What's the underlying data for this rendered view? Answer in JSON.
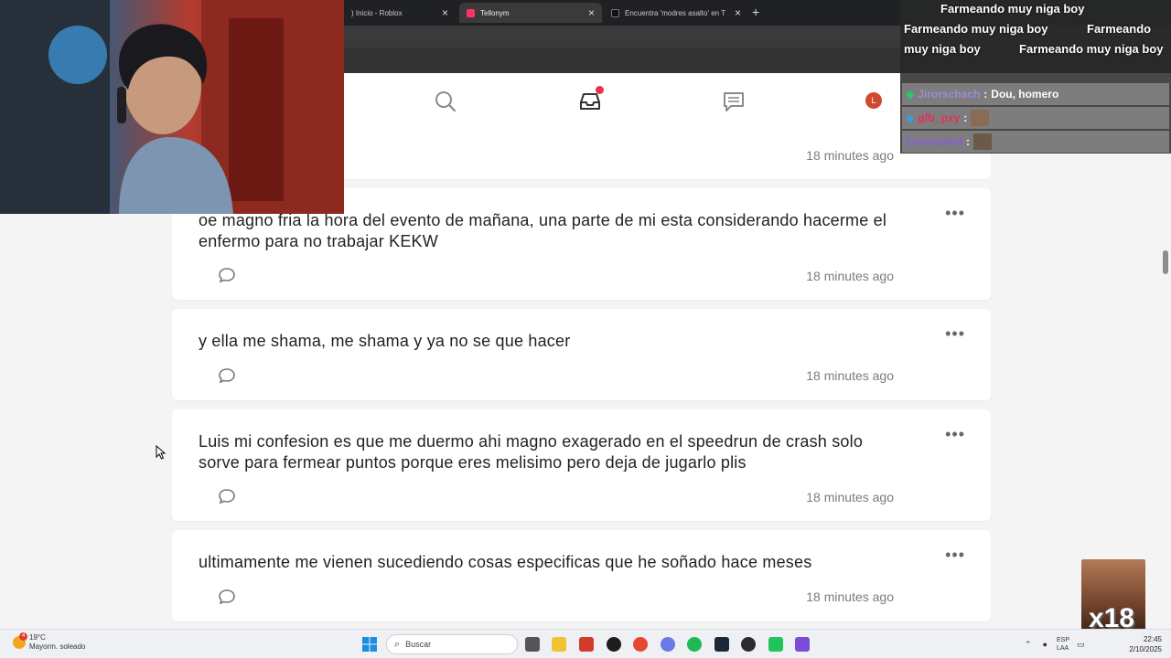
{
  "browser": {
    "tabs": [
      {
        "title": ") Inicio - Roblox",
        "active": false,
        "favicon_color": "#444444"
      },
      {
        "title": "Tellonym",
        "active": true,
        "favicon_color": "#ff3366"
      },
      {
        "title": "Encuentra 'modres asalto' en T",
        "active": false,
        "favicon_color": "#111111"
      }
    ],
    "new_tab": "+"
  },
  "appnav": {
    "avatar_letter": "L",
    "accent": "#e8334a"
  },
  "feed": {
    "cards": [
      {
        "message": "",
        "time": "18 minutes ago"
      },
      {
        "message": "oe magno fria la hora del evento de mañana, una parte de mi esta considerando hacerme el enfermo para no trabajar KEKW",
        "time": "18 minutes ago"
      },
      {
        "message": "y ella me shama, me shama y ya no se que hacer",
        "time": "18 minutes ago"
      },
      {
        "message": "Luis mi confesion es que me duermo ahi magno exagerado en el speedrun de crash solo sorve para fermear puntos porque eres melisimo pero deja de jugarlo plis",
        "time": "18 minutes ago"
      },
      {
        "message": "ultimamente me vienen sucediendo cosas especificas que he soñado hace meses",
        "time": "18 minutes ago"
      }
    ],
    "more_glyph": "•••"
  },
  "chat": {
    "farm_text": "Farmeando muy niga boy",
    "farm_text_split_a": "Farmeando",
    "farm_text_split_b": "muy niga boy",
    "messages": [
      {
        "user": "Jirorschach",
        "sep": ":",
        "text": "Dou, homero",
        "user_color": "#9d8bd8"
      },
      {
        "user": "gfb_pxy",
        "sep": ":",
        "text": "",
        "user_color": "#e0325a"
      },
      {
        "user": "Coctresmil",
        "sep": ":",
        "text": "",
        "user_color": "#8b5bd8"
      }
    ]
  },
  "sticker": {
    "text": "x18"
  },
  "taskbar": {
    "weather_temp": "19°C",
    "weather_desc": "Mayorm. soleado",
    "weather_badge": "4",
    "search_placeholder": "Buscar",
    "lang_top": "ESP",
    "lang_bottom": "LAA",
    "time": "22:45",
    "date": "2/10/2025"
  }
}
